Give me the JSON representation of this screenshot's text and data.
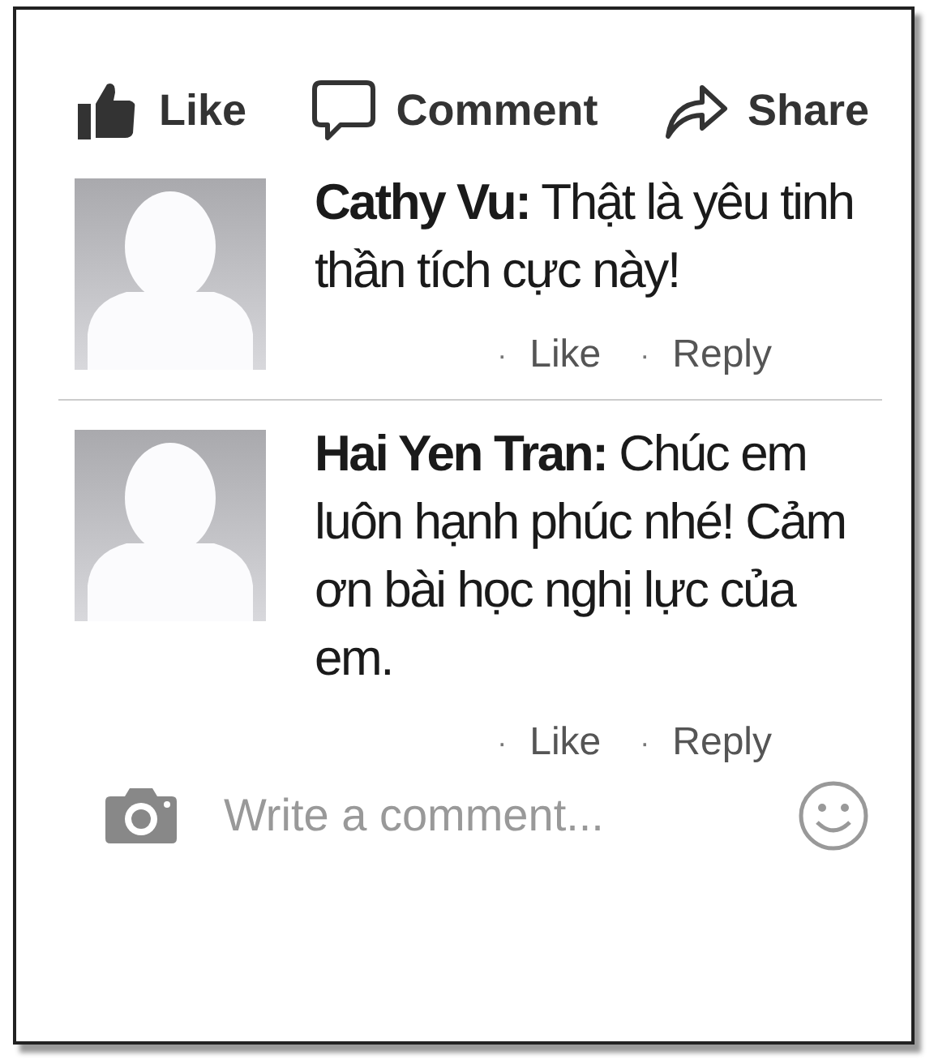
{
  "actions": [
    {
      "kind": "like",
      "label": "Like"
    },
    {
      "kind": "comment",
      "label": "Comment"
    },
    {
      "kind": "share",
      "label": "Share"
    }
  ],
  "comments": [
    {
      "text": "**Cathy Vu:** Thật là yêu tinh thần tích cực này!",
      "separator": "·",
      "buttons": [
        "Like",
        "Reply"
      ]
    },
    {
      "text": "**Hai Yen Tran:** Chúc em luôn hạnh phúc nhé! Cảm ơn bài học nghị lực của em.",
      "separator": "·",
      "buttons": [
        "Like",
        "Reply"
      ]
    }
  ],
  "composer": {
    "placeholder": "Write a comment..."
  }
}
